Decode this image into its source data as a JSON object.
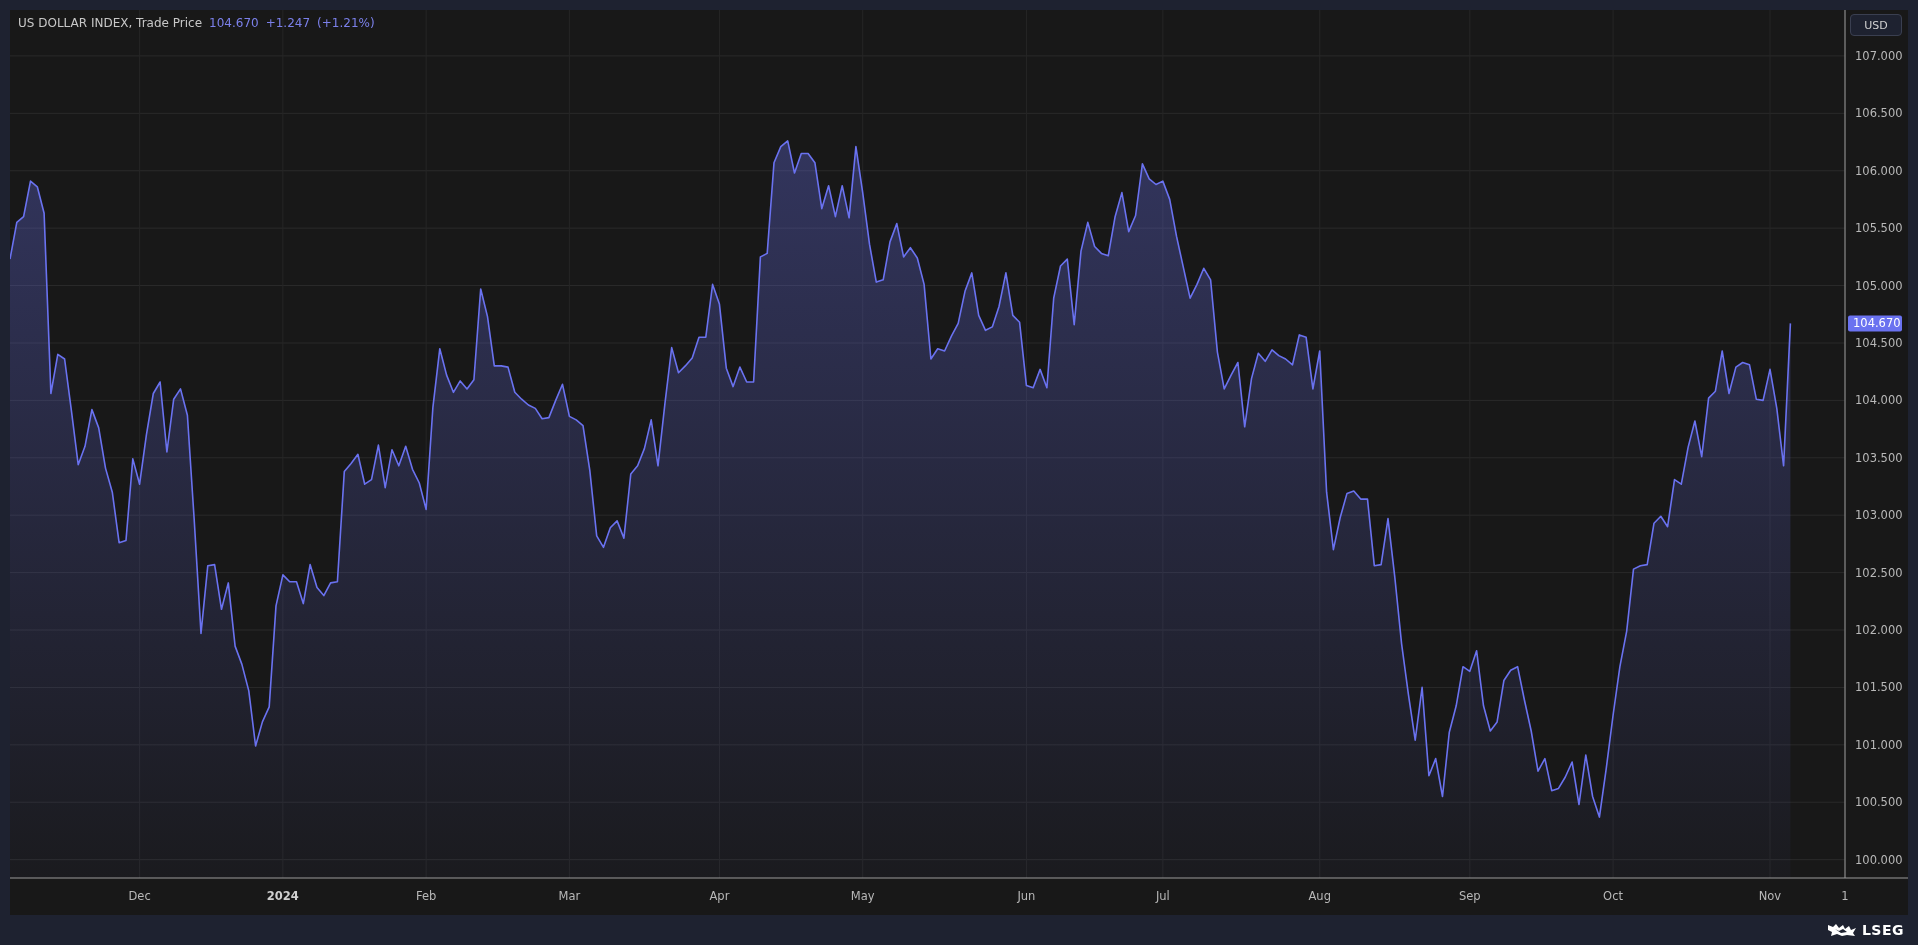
{
  "chart_header": {
    "last": "104.670",
    "change": "+1.247",
    "change_pct": "(+1.21%)"
  },
  "currency_button": "USD",
  "chart": {
    "last_price_label": "104.670",
    "chart_data": {
      "type": "area",
      "grid": true,
      "ylim": [
        99.84,
        107.4
      ],
      "categories": [
        null,
        null,
        null,
        null,
        null,
        null,
        null,
        null,
        null,
        null,
        null,
        null,
        null,
        null,
        null,
        null,
        null,
        null,
        null,
        "Dec",
        null,
        null,
        null,
        null,
        null,
        null,
        null,
        null,
        null,
        null,
        null,
        null,
        null,
        null,
        null,
        null,
        null,
        null,
        null,
        null,
        "2024",
        null,
        null,
        null,
        null,
        null,
        null,
        null,
        null,
        null,
        null,
        null,
        null,
        null,
        null,
        null,
        null,
        null,
        null,
        null,
        null,
        "Feb",
        null,
        null,
        null,
        null,
        null,
        null,
        null,
        null,
        null,
        null,
        null,
        null,
        null,
        null,
        null,
        null,
        null,
        null,
        null,
        null,
        "Mar",
        null,
        null,
        null,
        null,
        null,
        null,
        null,
        null,
        null,
        null,
        null,
        null,
        null,
        null,
        null,
        null,
        null,
        null,
        null,
        null,
        null,
        "Apr",
        null,
        null,
        null,
        null,
        null,
        null,
        null,
        null,
        null,
        null,
        null,
        null,
        null,
        null,
        null,
        null,
        null,
        null,
        null,
        null,
        "May",
        null,
        null,
        null,
        null,
        null,
        null,
        null,
        null,
        null,
        null,
        null,
        null,
        null,
        null,
        null,
        null,
        null,
        null,
        null,
        null,
        null,
        null,
        null,
        "Jun",
        null,
        null,
        null,
        null,
        null,
        null,
        null,
        null,
        null,
        null,
        null,
        null,
        null,
        null,
        null,
        null,
        null,
        null,
        null,
        "Jul",
        null,
        null,
        null,
        null,
        null,
        null,
        null,
        null,
        null,
        null,
        null,
        null,
        null,
        null,
        null,
        null,
        null,
        null,
        null,
        null,
        null,
        null,
        "Aug",
        null,
        null,
        null,
        null,
        null,
        null,
        null,
        null,
        null,
        null,
        null,
        null,
        null,
        null,
        null,
        null,
        null,
        null,
        null,
        null,
        null,
        "Sep",
        null,
        null,
        null,
        null,
        null,
        null,
        null,
        null,
        null,
        null,
        null,
        null,
        null,
        null,
        null,
        null,
        null,
        null,
        null,
        null,
        "Oct",
        null,
        null,
        null,
        null,
        null,
        null,
        null,
        null,
        null,
        null,
        null,
        null,
        null,
        null,
        null,
        null,
        null,
        null,
        null,
        null,
        null,
        null,
        "Nov",
        null,
        null,
        null,
        null,
        null,
        null,
        null,
        null,
        null,
        null,
        "1"
      ],
      "series": [
        {
          "name": "US DOLLAR INDEX, Trade Price",
          "color": "#6a72f0",
          "values": [
            105.23,
            105.55,
            105.6,
            105.91,
            105.86,
            105.63,
            104.06,
            104.4,
            104.36,
            103.91,
            103.44,
            103.6,
            103.92,
            103.76,
            103.41,
            103.2,
            102.76,
            102.78,
            103.49,
            103.27,
            103.7,
            104.06,
            104.16,
            103.55,
            104.01,
            104.1,
            103.87,
            102.96,
            101.97,
            102.56,
            102.57,
            102.18,
            102.41,
            101.86,
            101.7,
            101.47,
            100.99,
            101.2,
            101.33,
            102.21,
            102.48,
            102.42,
            102.42,
            102.23,
            102.57,
            102.37,
            102.3,
            102.41,
            102.42,
            103.38,
            103.45,
            103.53,
            103.27,
            103.31,
            103.61,
            103.24,
            103.57,
            103.43,
            103.6,
            103.4,
            103.28,
            103.05,
            103.94,
            104.45,
            104.22,
            104.07,
            104.17,
            104.1,
            104.18,
            104.97,
            104.73,
            104.3,
            104.3,
            104.29,
            104.07,
            104.01,
            103.96,
            103.93,
            103.84,
            103.85,
            104.0,
            104.14,
            103.86,
            103.83,
            103.78,
            103.39,
            102.82,
            102.72,
            102.89,
            102.95,
            102.8,
            103.36,
            103.43,
            103.58,
            103.83,
            103.43,
            103.97,
            104.46,
            104.24,
            104.3,
            104.37,
            104.55,
            104.55,
            105.01,
            104.84,
            104.28,
            104.12,
            104.29,
            104.16,
            104.16,
            105.25,
            105.28,
            106.07,
            106.21,
            106.26,
            105.98,
            106.15,
            106.15,
            106.07,
            105.67,
            105.87,
            105.6,
            105.87,
            105.59,
            106.21,
            105.81,
            105.36,
            105.03,
            105.05,
            105.38,
            105.54,
            105.25,
            105.33,
            105.24,
            105.01,
            104.36,
            104.45,
            104.43,
            104.56,
            104.67,
            104.95,
            105.11,
            104.74,
            104.61,
            104.64,
            104.82,
            105.11,
            104.74,
            104.68,
            104.13,
            104.11,
            104.27,
            104.11,
            104.89,
            105.17,
            105.23,
            104.66,
            105.3,
            105.55,
            105.34,
            105.28,
            105.26,
            105.6,
            105.81,
            105.47,
            105.61,
            106.06,
            105.93,
            105.88,
            105.91,
            105.75,
            105.43,
            105.16,
            104.89,
            105.01,
            105.15,
            105.05,
            104.42,
            104.1,
            104.22,
            104.33,
            103.77,
            104.19,
            104.41,
            104.34,
            104.44,
            104.39,
            104.36,
            104.31,
            104.57,
            104.55,
            104.1,
            104.43,
            103.2,
            102.7,
            102.98,
            103.19,
            103.21,
            103.14,
            103.14,
            102.56,
            102.57,
            102.97,
            102.46,
            101.88,
            101.44,
            101.04,
            101.5,
            100.73,
            100.88,
            100.55,
            101.11,
            101.34,
            101.68,
            101.64,
            101.82,
            101.34,
            101.12,
            101.2,
            101.56,
            101.65,
            101.68,
            101.39,
            101.12,
            100.77,
            100.88,
            100.6,
            100.62,
            100.72,
            100.85,
            100.48,
            100.91,
            100.55,
            100.37,
            100.79,
            101.26,
            101.68,
            101.99,
            102.53,
            102.56,
            102.57,
            102.93,
            102.99,
            102.9,
            103.31,
            103.27,
            103.59,
            103.82,
            103.51,
            104.02,
            104.08,
            104.43,
            104.06,
            104.29,
            104.33,
            104.31,
            104.01,
            104.0,
            104.27,
            103.93,
            103.43,
            104.67,
            null,
            null,
            null,
            null,
            null,
            null,
            null,
            null
          ]
        }
      ],
      "yticks": [
        {
          "value": 100,
          "label": "100.000"
        },
        {
          "value": 100.5,
          "label": "100.500"
        },
        {
          "value": 101,
          "label": "101.000"
        },
        {
          "value": 101.5,
          "label": "101.500"
        },
        {
          "value": 102,
          "label": "102.000"
        },
        {
          "value": 102.5,
          "label": "102.500"
        },
        {
          "value": 103,
          "label": "103.000"
        },
        {
          "value": 103.5,
          "label": "103.500"
        },
        {
          "value": 104,
          "label": "104.000"
        },
        {
          "value": 104.5,
          "label": "104.500"
        },
        {
          "value": 105,
          "label": "105.000"
        },
        {
          "value": 105.5,
          "label": "105.500"
        },
        {
          "value": 106,
          "label": "106.000"
        },
        {
          "value": 106.5,
          "label": "106.500"
        },
        {
          "value": 107,
          "label": "107.000"
        }
      ]
    }
  },
  "footer": {
    "brand": "LSEG"
  }
}
